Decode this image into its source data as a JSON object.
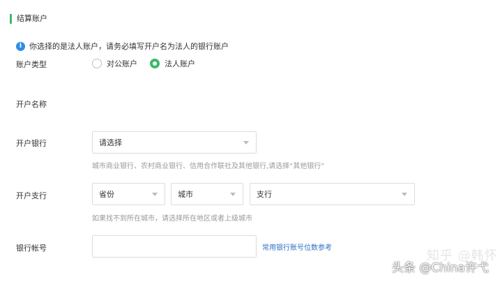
{
  "section": {
    "title": "结算账户"
  },
  "notice": {
    "icon": "info-icon",
    "text": "你选择的是法人账户，请务必填写开户名为法人的银行账户"
  },
  "account_type": {
    "label": "账户类型",
    "options": [
      {
        "label": "对公账户",
        "checked": false
      },
      {
        "label": "法人账户",
        "checked": true
      }
    ]
  },
  "account_name": {
    "label": "开户名称"
  },
  "bank": {
    "label": "开户银行",
    "select_value": "请选择",
    "hint": "城市商业银行、农村商业银行、信用合作联社及其他银行,请选择“其他银行”"
  },
  "branch": {
    "label": "开户支行",
    "province": "省份",
    "city": "城市",
    "branch": "支行",
    "hint": "如果找不到所在城市，请选择所在地区或者上级城市"
  },
  "account_number": {
    "label": "银行帐号",
    "value": "",
    "link": "常用银行账号位数参考"
  },
  "watermark": {
    "faint": "知乎 @韩怀",
    "main": "头条 @China许弋"
  },
  "colors": {
    "accent": "#3cb96b",
    "info": "#2f8de4",
    "link": "#2f72c4"
  }
}
